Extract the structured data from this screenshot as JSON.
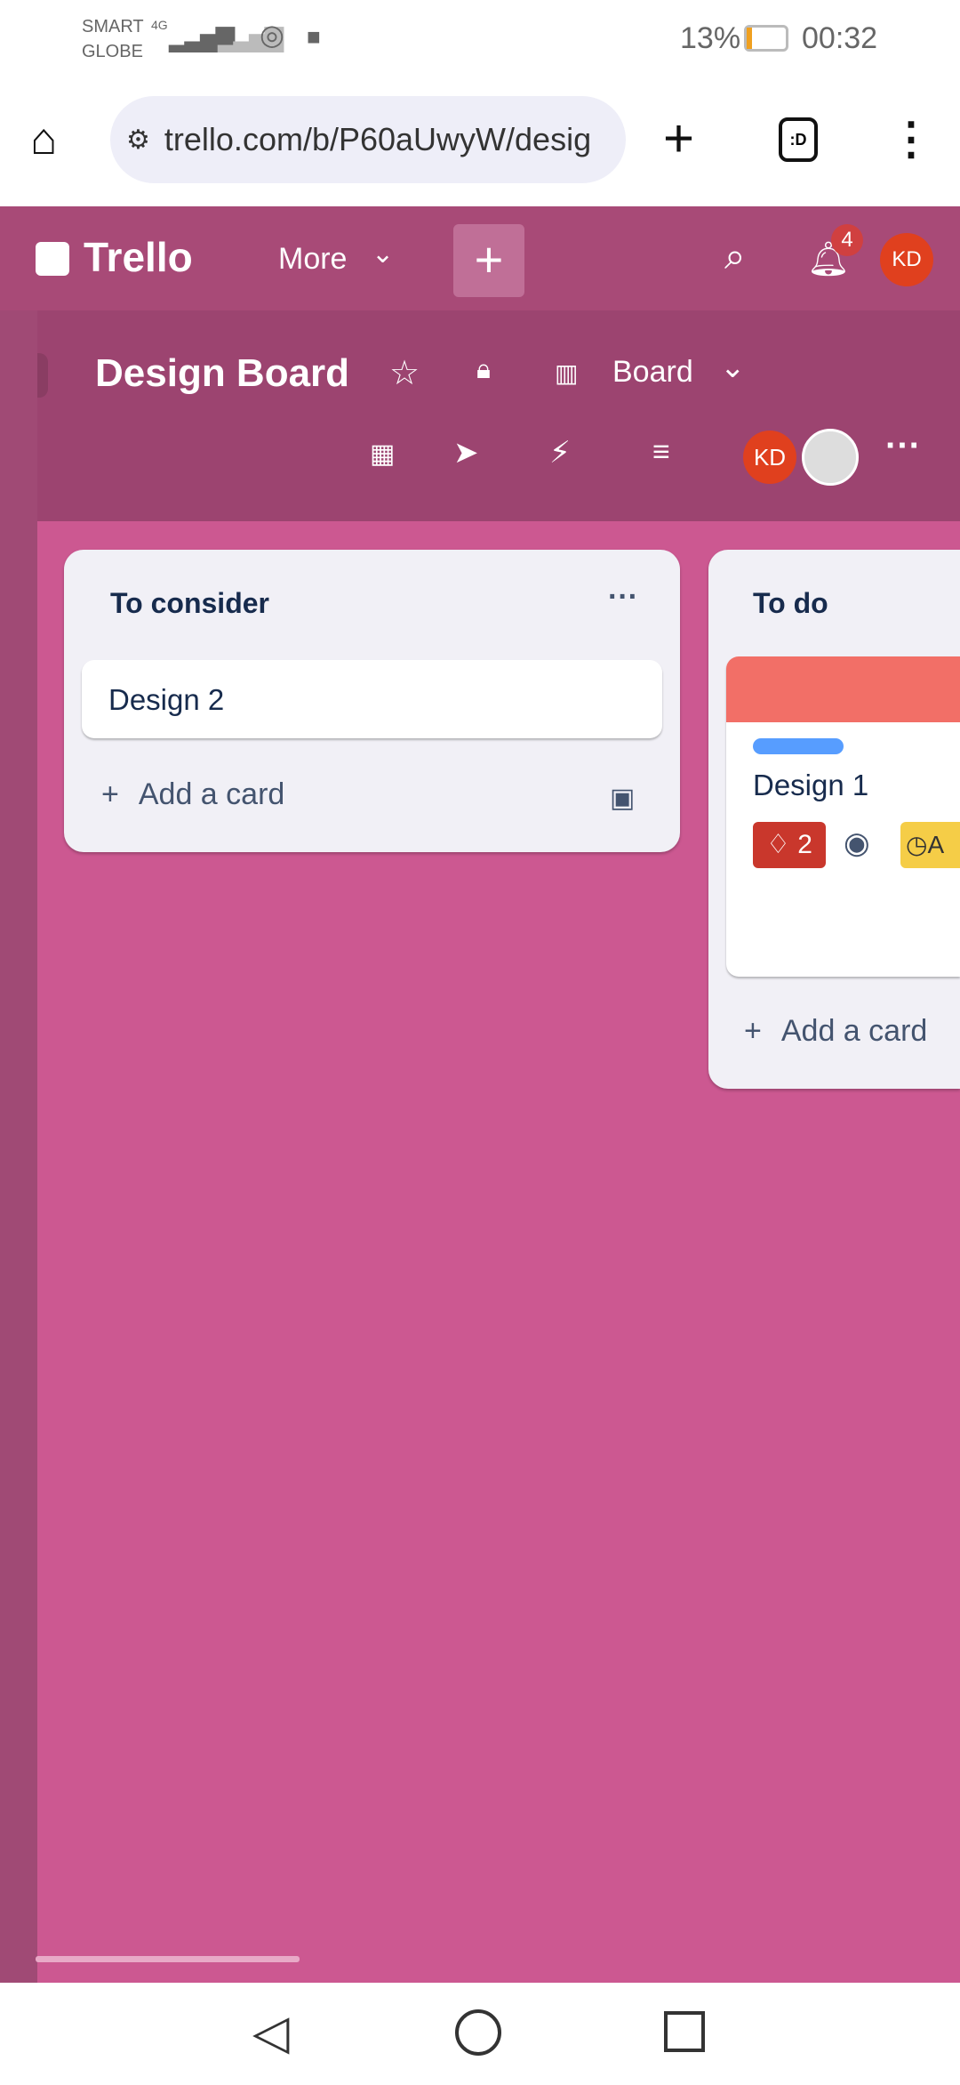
{
  "status": {
    "carrier1": "SMART",
    "carrier2": "GLOBE",
    "net": "4G",
    "battery": "13%",
    "time": "00:32",
    "battery_level": 13
  },
  "browser": {
    "url": "trello.com/b/P60aUwyW/desig"
  },
  "topbar": {
    "logo": "Trello",
    "more": "More",
    "notifications": "4",
    "avatar": "KD"
  },
  "board": {
    "title": "Design Board",
    "view": "Board",
    "member": "KD"
  },
  "lists": [
    {
      "title": "To consider",
      "cards": [
        {
          "title": "Design 2"
        }
      ],
      "add": "Add a card"
    },
    {
      "title": "To do",
      "cards": [
        {
          "title": "Design 1",
          "cover": "#f26f67",
          "label": "#579dff",
          "notif_count": "2",
          "due": "A"
        }
      ],
      "add": "Add a card"
    }
  ],
  "colors": {
    "board_bg": "#cc5891",
    "header": "#a84a77",
    "accent_red": "#c9372c",
    "due_yellow": "#f5cd47"
  }
}
